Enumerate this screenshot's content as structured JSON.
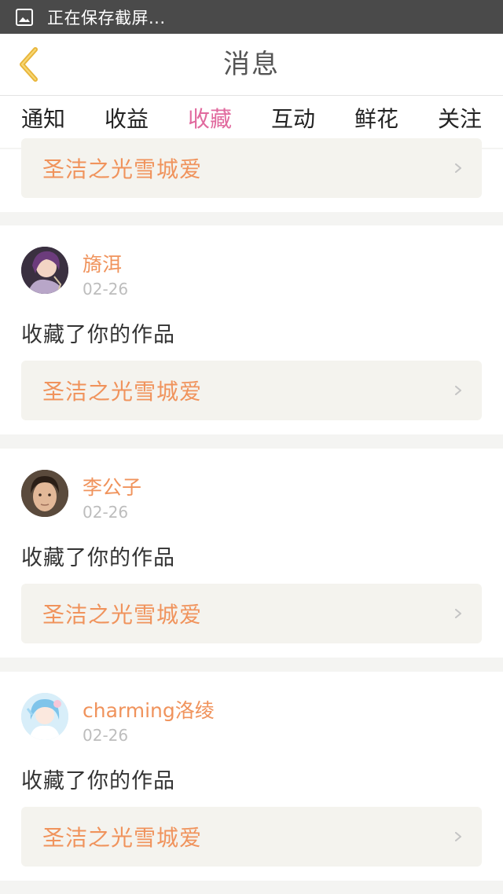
{
  "status_bar": {
    "text": "正在保存截屏...",
    "icon": "image-icon"
  },
  "header": {
    "title": "消息",
    "back_icon": "chevron-left-icon"
  },
  "tabs": [
    {
      "label": "通知",
      "active": false
    },
    {
      "label": "收益",
      "active": false
    },
    {
      "label": "收藏",
      "active": true
    },
    {
      "label": "互动",
      "active": false
    },
    {
      "label": "鲜花",
      "active": false
    },
    {
      "label": "关注",
      "active": false
    }
  ],
  "partial_item": {
    "work_title": "圣洁之光雪城爱"
  },
  "items": [
    {
      "user": "旖洱",
      "date": "02-26",
      "action": "收藏了你的作品",
      "work_title": "圣洁之光雪城爱",
      "avatar_icon": "avatar-icon"
    },
    {
      "user": "李公子",
      "date": "02-26",
      "action": "收藏了你的作品",
      "work_title": "圣洁之光雪城爱",
      "avatar_icon": "avatar-icon"
    },
    {
      "user": "charming洛绫",
      "date": "02-26",
      "action": "收藏了你的作品",
      "work_title": "圣洁之光雪城爱",
      "avatar_icon": "avatar-icon"
    }
  ],
  "colors": {
    "accent": "#e16a9e",
    "orange": "#f0935c",
    "date_gray": "#bdbdbd",
    "work_bg": "#f4f3ee",
    "back_arrow": "#e8b53a"
  }
}
